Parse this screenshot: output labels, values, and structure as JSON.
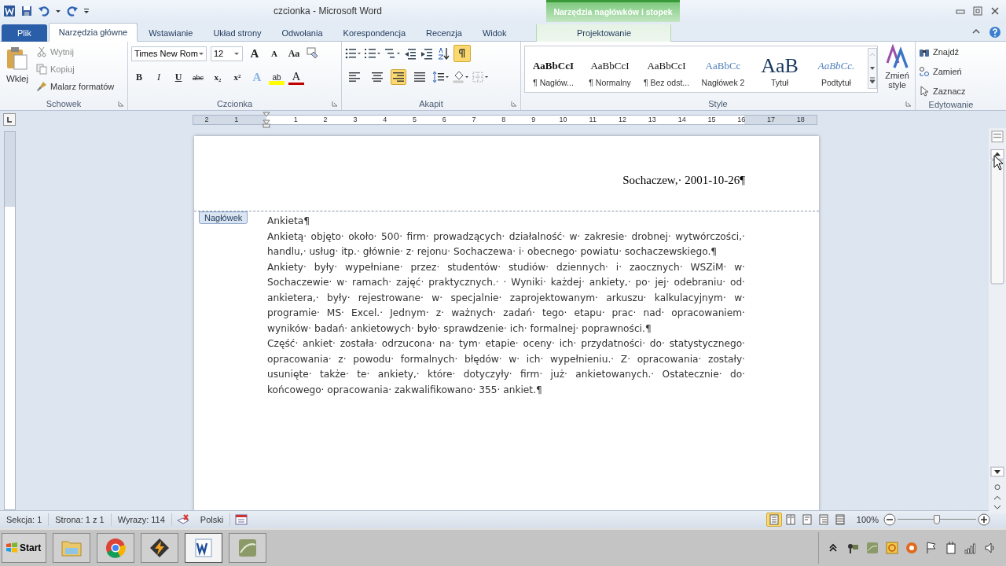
{
  "window": {
    "title": "czcionka - Microsoft Word",
    "contextual_tab": "Narzędzia nagłówków i stopek"
  },
  "tabs": [
    {
      "label": "Plik",
      "kind": "file",
      "selected": false
    },
    {
      "label": "Narzędzia główne",
      "kind": "normal",
      "selected": true
    },
    {
      "label": "Wstawianie",
      "kind": "normal",
      "selected": false
    },
    {
      "label": "Układ strony",
      "kind": "normal",
      "selected": false
    },
    {
      "label": "Odwołania",
      "kind": "normal",
      "selected": false
    },
    {
      "label": "Korespondencja",
      "kind": "normal",
      "selected": false
    },
    {
      "label": "Recenzja",
      "kind": "normal",
      "selected": false
    },
    {
      "label": "Widok",
      "kind": "normal",
      "selected": false
    },
    {
      "label": "Projektowanie",
      "kind": "contextual",
      "selected": false
    }
  ],
  "ribbon": {
    "clipboard": {
      "title": "Schowek",
      "paste": "Wklej",
      "items": [
        "Wytnij",
        "Kopiuj",
        "Malarz formatów"
      ]
    },
    "font": {
      "title": "Czcionka",
      "name": "Times New Rom",
      "size": "12",
      "top_buttons": [
        {
          "glyph": "A",
          "kind": "grow"
        },
        {
          "glyph": "A",
          "kind": "shrink"
        },
        {
          "glyph": "Aa",
          "kind": "case"
        }
      ],
      "format_buttons": [
        {
          "glyph": "B",
          "kind": "bold"
        },
        {
          "glyph": "I",
          "kind": "italic"
        },
        {
          "glyph": "U",
          "kind": "underline"
        },
        {
          "glyph": "abc",
          "kind": "strike"
        },
        {
          "glyph": "x₂",
          "kind": "sub"
        },
        {
          "glyph": "x²",
          "kind": "sup"
        },
        {
          "glyph": "A",
          "kind": "effect"
        },
        {
          "glyph": "ab",
          "kind": "highlight"
        },
        {
          "glyph": "A",
          "kind": "color"
        }
      ]
    },
    "paragraph": {
      "title": "Akapit",
      "show_marks": true,
      "alignments": [
        {
          "selected": false
        },
        {
          "selected": false
        },
        {
          "selected": true
        },
        {
          "selected": false
        }
      ]
    },
    "styles": {
      "title": "Style",
      "items": [
        {
          "sample": "AaBbCcI",
          "name": "¶ Nagłów...",
          "kind": "heading1"
        },
        {
          "sample": "AaBbCcI",
          "name": "¶ Normalny",
          "kind": "normal"
        },
        {
          "sample": "AaBbCcI",
          "name": "¶ Bez odst...",
          "kind": "normal"
        },
        {
          "sample": "AaBbCc",
          "name": "Nagłówek 2",
          "kind": "heading2"
        },
        {
          "sample": "AaB",
          "name": "Tytuł",
          "kind": "title"
        },
        {
          "sample": "AaBbCc.",
          "name": "Podtytuł",
          "kind": "subtitle"
        }
      ],
      "change": "Zmień style"
    },
    "editing": {
      "title": "Edytowanie",
      "items": [
        "Znajdź",
        "Zamień",
        "Zaznacz"
      ]
    }
  },
  "ruler_numbers": [
    "2",
    "1",
    "1",
    "2",
    "3",
    "4",
    "5",
    "6",
    "7",
    "8",
    "9",
    "10",
    "11",
    "12",
    "13",
    "14",
    "15",
    "16",
    "17",
    "18"
  ],
  "document": {
    "header_tag": "Nagłówek",
    "header_text": "Sochaczew,· 2001-10-26¶",
    "title": "Ankieta¶",
    "paragraphs": [
      "Ankietą· objęto· około· 500· firm· prowadzących· działalność· w· zakresie· drobnej· wytwórczości,· handlu,· usług· itp.· głównie· z· rejonu· Sochaczewa· i· obecnego· powiatu· sochaczewskiego.¶",
      "Ankiety· były· wypełniane· przez· studentów· studiów· dziennych· i· zaocznych· WSZiM· w· Sochaczewie· w· ramach· zajęć· praktycznych.· · Wyniki· każdej· ankiety,· po· jej· odebraniu· od· ankietera,· były· rejestrowane· w· specjalnie· zaprojektowanym· arkuszu· kalkulacyjnym· w· programie· MS· Excel.· Jednym· z· ważnych· zadań· tego· etapu· prac· nad· opracowaniem· wyników· badań· ankietowych· było· sprawdzenie· ich· formalnej· poprawności.¶",
      "Część· ankiet· została· odrzucona· na· tym· etapie· oceny· ich· przydatności· do· statystycznego· opracowania· z· powodu· formalnych· błędów· w· ich· wypełnieniu.· Z· opracowania· zostały· usunięte· także· te· ankiety,· które· dotyczyły· firm· już· ankietowanych.· Ostatecznie· do· końcowego· opracowania· zakwalifikowano· 355· ankiet.¶"
    ]
  },
  "status_bar": {
    "items": [
      "Sekcja: 1",
      "Strona: 1 z 1",
      "Wyrazy: 114"
    ],
    "language": "Polski",
    "views": [
      {
        "selected": true
      },
      {
        "selected": false
      },
      {
        "selected": false
      },
      {
        "selected": false
      },
      {
        "selected": false
      }
    ],
    "zoom": "100%",
    "zoom_level": {
      "level": 0.5
    }
  },
  "taskbar": {
    "start": "Start",
    "apps": [
      {
        "kind": "folder",
        "selected": false
      },
      {
        "kind": "browser",
        "selected": false
      },
      {
        "kind": "player",
        "selected": false
      },
      {
        "kind": "word",
        "selected": true
      },
      {
        "kind": "app",
        "selected": false
      }
    ]
  }
}
